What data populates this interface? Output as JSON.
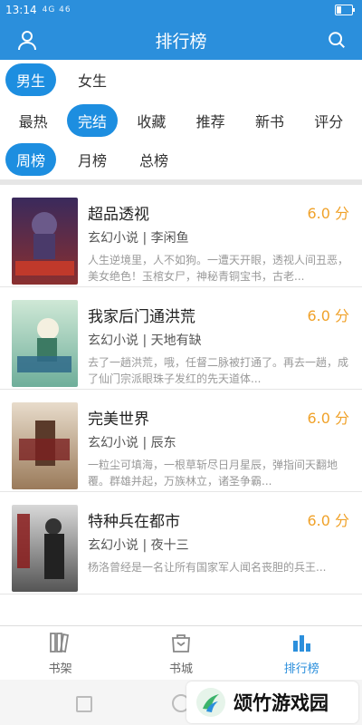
{
  "status": {
    "time": "13:14",
    "signal": "4G 46",
    "battery_fraction": 0.3
  },
  "header": {
    "title": "排行榜",
    "left_icon": "user-icon",
    "right_icon": "search-icon"
  },
  "gender_tabs": [
    "男生",
    "女生"
  ],
  "sort_tabs": [
    "最热",
    "完结",
    "收藏",
    "推荐",
    "新书",
    "评分"
  ],
  "period_tabs": [
    "周榜",
    "月榜",
    "总榜"
  ],
  "selected": {
    "gender": 0,
    "sort": 1,
    "period": 0
  },
  "books": [
    {
      "title": "超品透视",
      "score": "6.0 分",
      "category": "玄幻小说",
      "author": "李闲鱼",
      "desc": "人生逆境里，人不如狗。一遭天开眼，透视人间丑恶，美女绝色！玉棺女尸，神秘青铜宝书，古老..."
    },
    {
      "title": "我家后门通洪荒",
      "score": "6.0 分",
      "category": "玄幻小说",
      "author": "天地有缺",
      "desc": "去了一趟洪荒，哦，任督二脉被打通了。再去一趟，成了仙门宗派眼珠子发红的先天道体..."
    },
    {
      "title": "完美世界",
      "score": "6.0 分",
      "category": "玄幻小说",
      "author": "辰东",
      "desc": "一粒尘可填海，一根草斩尽日月星辰，弹指间天翻地覆。群雄并起，万族林立，诸圣争霸..."
    },
    {
      "title": "特种兵在都市",
      "score": "6.0 分",
      "category": "玄幻小说",
      "author": "夜十三",
      "desc": "杨洛曾经是一名让所有国家军人闻名丧胆的兵王..."
    }
  ],
  "bottom_tabs": [
    {
      "label": "书架",
      "icon": "bookshelf-icon"
    },
    {
      "label": "书城",
      "icon": "bookstore-bag-icon"
    },
    {
      "label": "排行榜",
      "icon": "ranking-icon"
    }
  ],
  "watermark": {
    "text": "颂竹游戏园"
  },
  "colors": {
    "primary": "#2b8fdc",
    "score": "#f0a22a"
  }
}
